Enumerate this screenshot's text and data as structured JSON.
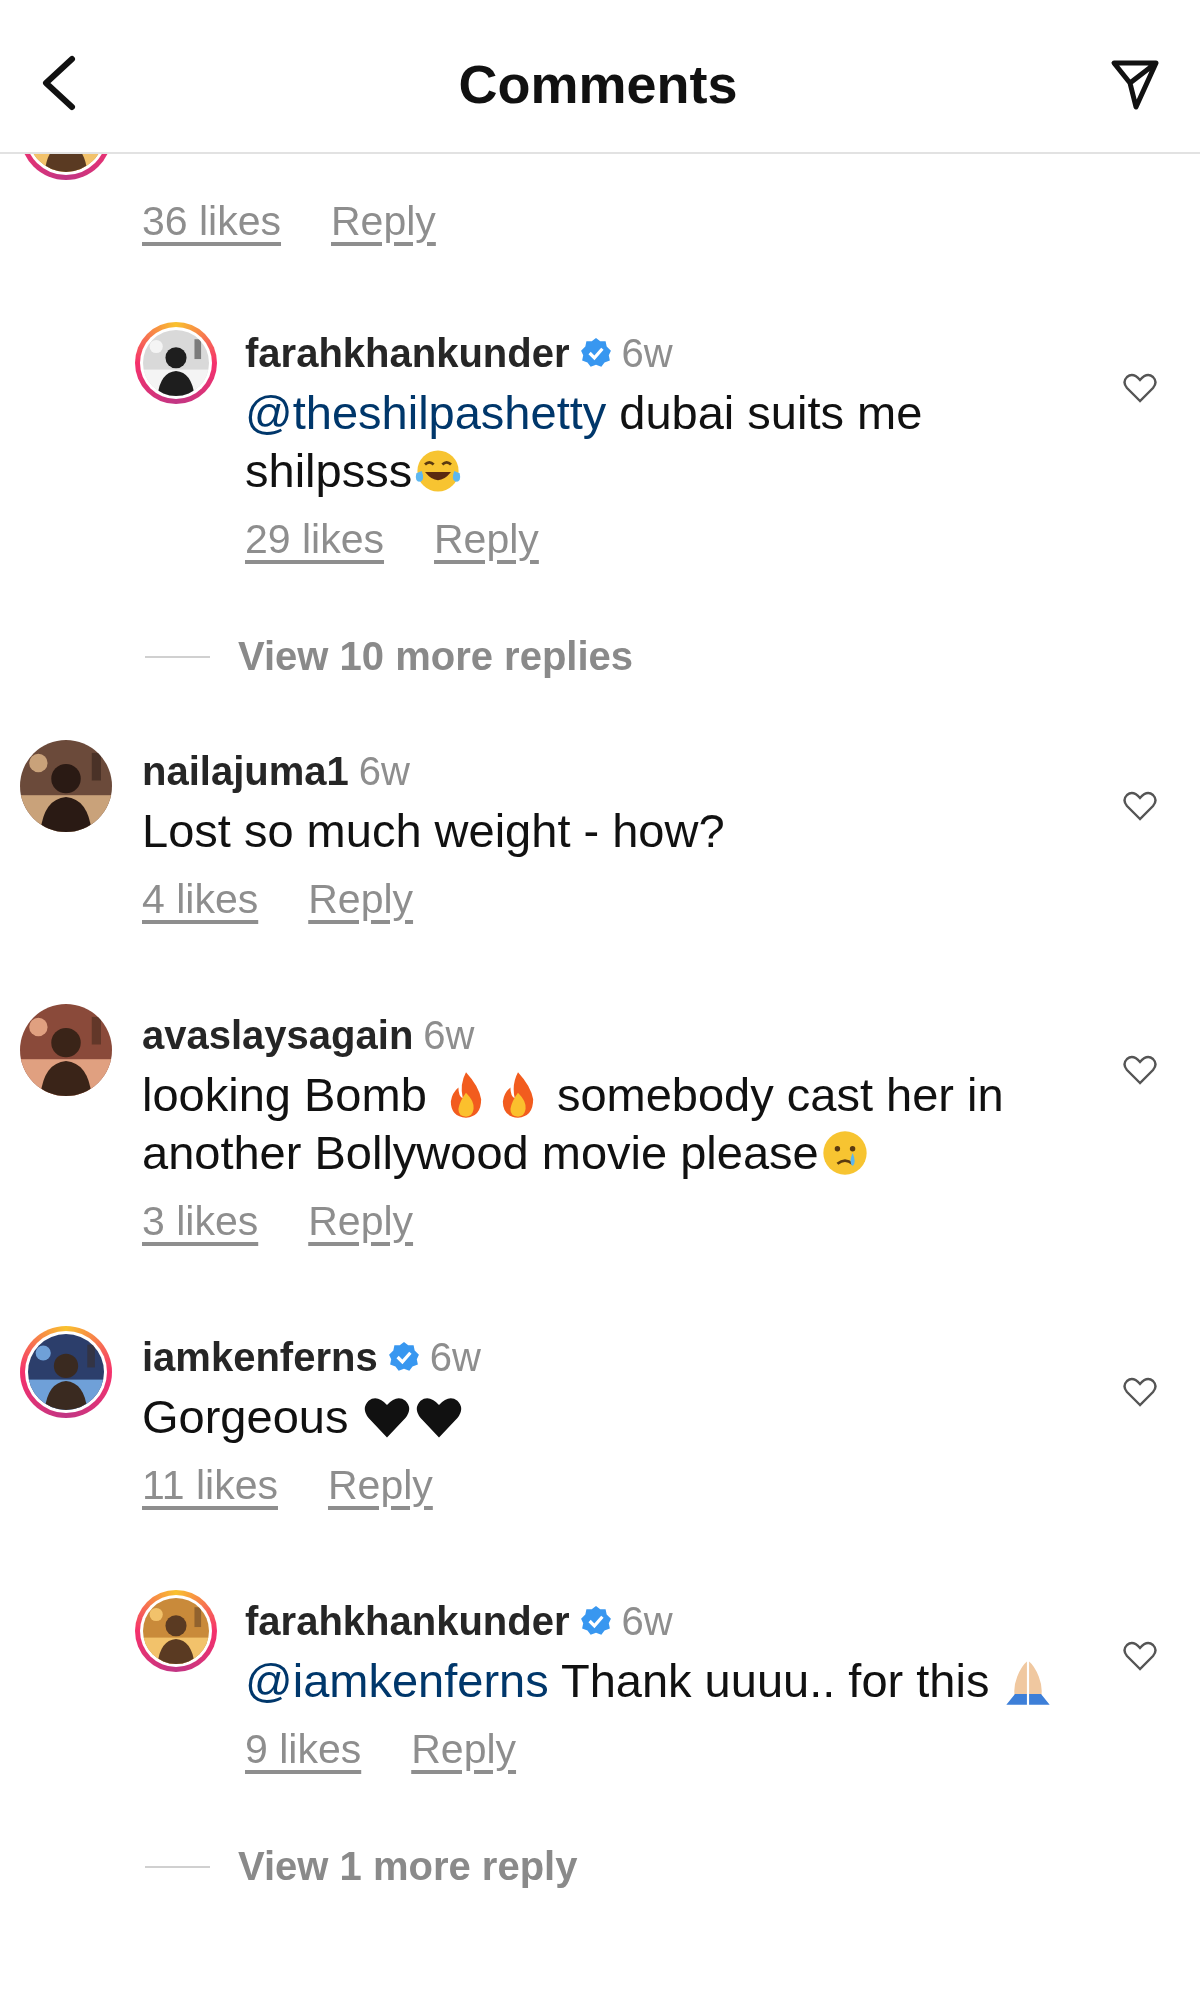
{
  "header": {
    "title": "Comments"
  },
  "comments": [
    {
      "story_ring": true,
      "likes": "36 likes",
      "reply_label": "Reply",
      "replies": [
        {
          "user": "farahkhankunder",
          "verified": true,
          "time": "6w",
          "story_ring": true,
          "liked": false,
          "text": [
            {
              "kind": "mention",
              "text": "@theshilpashetty"
            },
            {
              "kind": "text",
              "text": " dubai suits me shilpsss"
            },
            {
              "kind": "laugh"
            }
          ],
          "likes": "29 likes",
          "reply_label": "Reply"
        }
      ],
      "view_more": "View 10 more replies"
    },
    {
      "user": "nailajuma1",
      "verified": false,
      "time": "6w",
      "story_ring": false,
      "liked": false,
      "text": [
        {
          "kind": "text",
          "text": "Lost so much weight - how?"
        }
      ],
      "likes": "4 likes",
      "reply_label": "Reply"
    },
    {
      "user": "avaslaysagain",
      "verified": false,
      "time": "6w",
      "story_ring": false,
      "liked": false,
      "text": [
        {
          "kind": "text",
          "text": "looking Bomb "
        },
        {
          "kind": "fire"
        },
        {
          "kind": "fire"
        },
        {
          "kind": "text",
          "text": " somebody cast her in another Bollywood movie please"
        },
        {
          "kind": "cry"
        }
      ],
      "likes": "3 likes",
      "reply_label": "Reply"
    },
    {
      "user": "iamkenferns",
      "verified": true,
      "time": "6w",
      "story_ring": true,
      "liked": false,
      "text": [
        {
          "kind": "text",
          "text": "Gorgeous "
        },
        {
          "kind": "black-heart"
        },
        {
          "kind": "black-heart"
        }
      ],
      "likes": "11 likes",
      "reply_label": "Reply",
      "replies": [
        {
          "user": "farahkhankunder",
          "verified": true,
          "time": "6w",
          "story_ring": true,
          "liked": false,
          "text": [
            {
              "kind": "mention",
              "text": "@iamkenferns"
            },
            {
              "kind": "text",
              "text": " Thank uuuu.. for this "
            },
            {
              "kind": "pray"
            }
          ],
          "likes": "9 likes",
          "reply_label": "Reply"
        }
      ],
      "view_more": "View 1 more reply"
    }
  ]
}
